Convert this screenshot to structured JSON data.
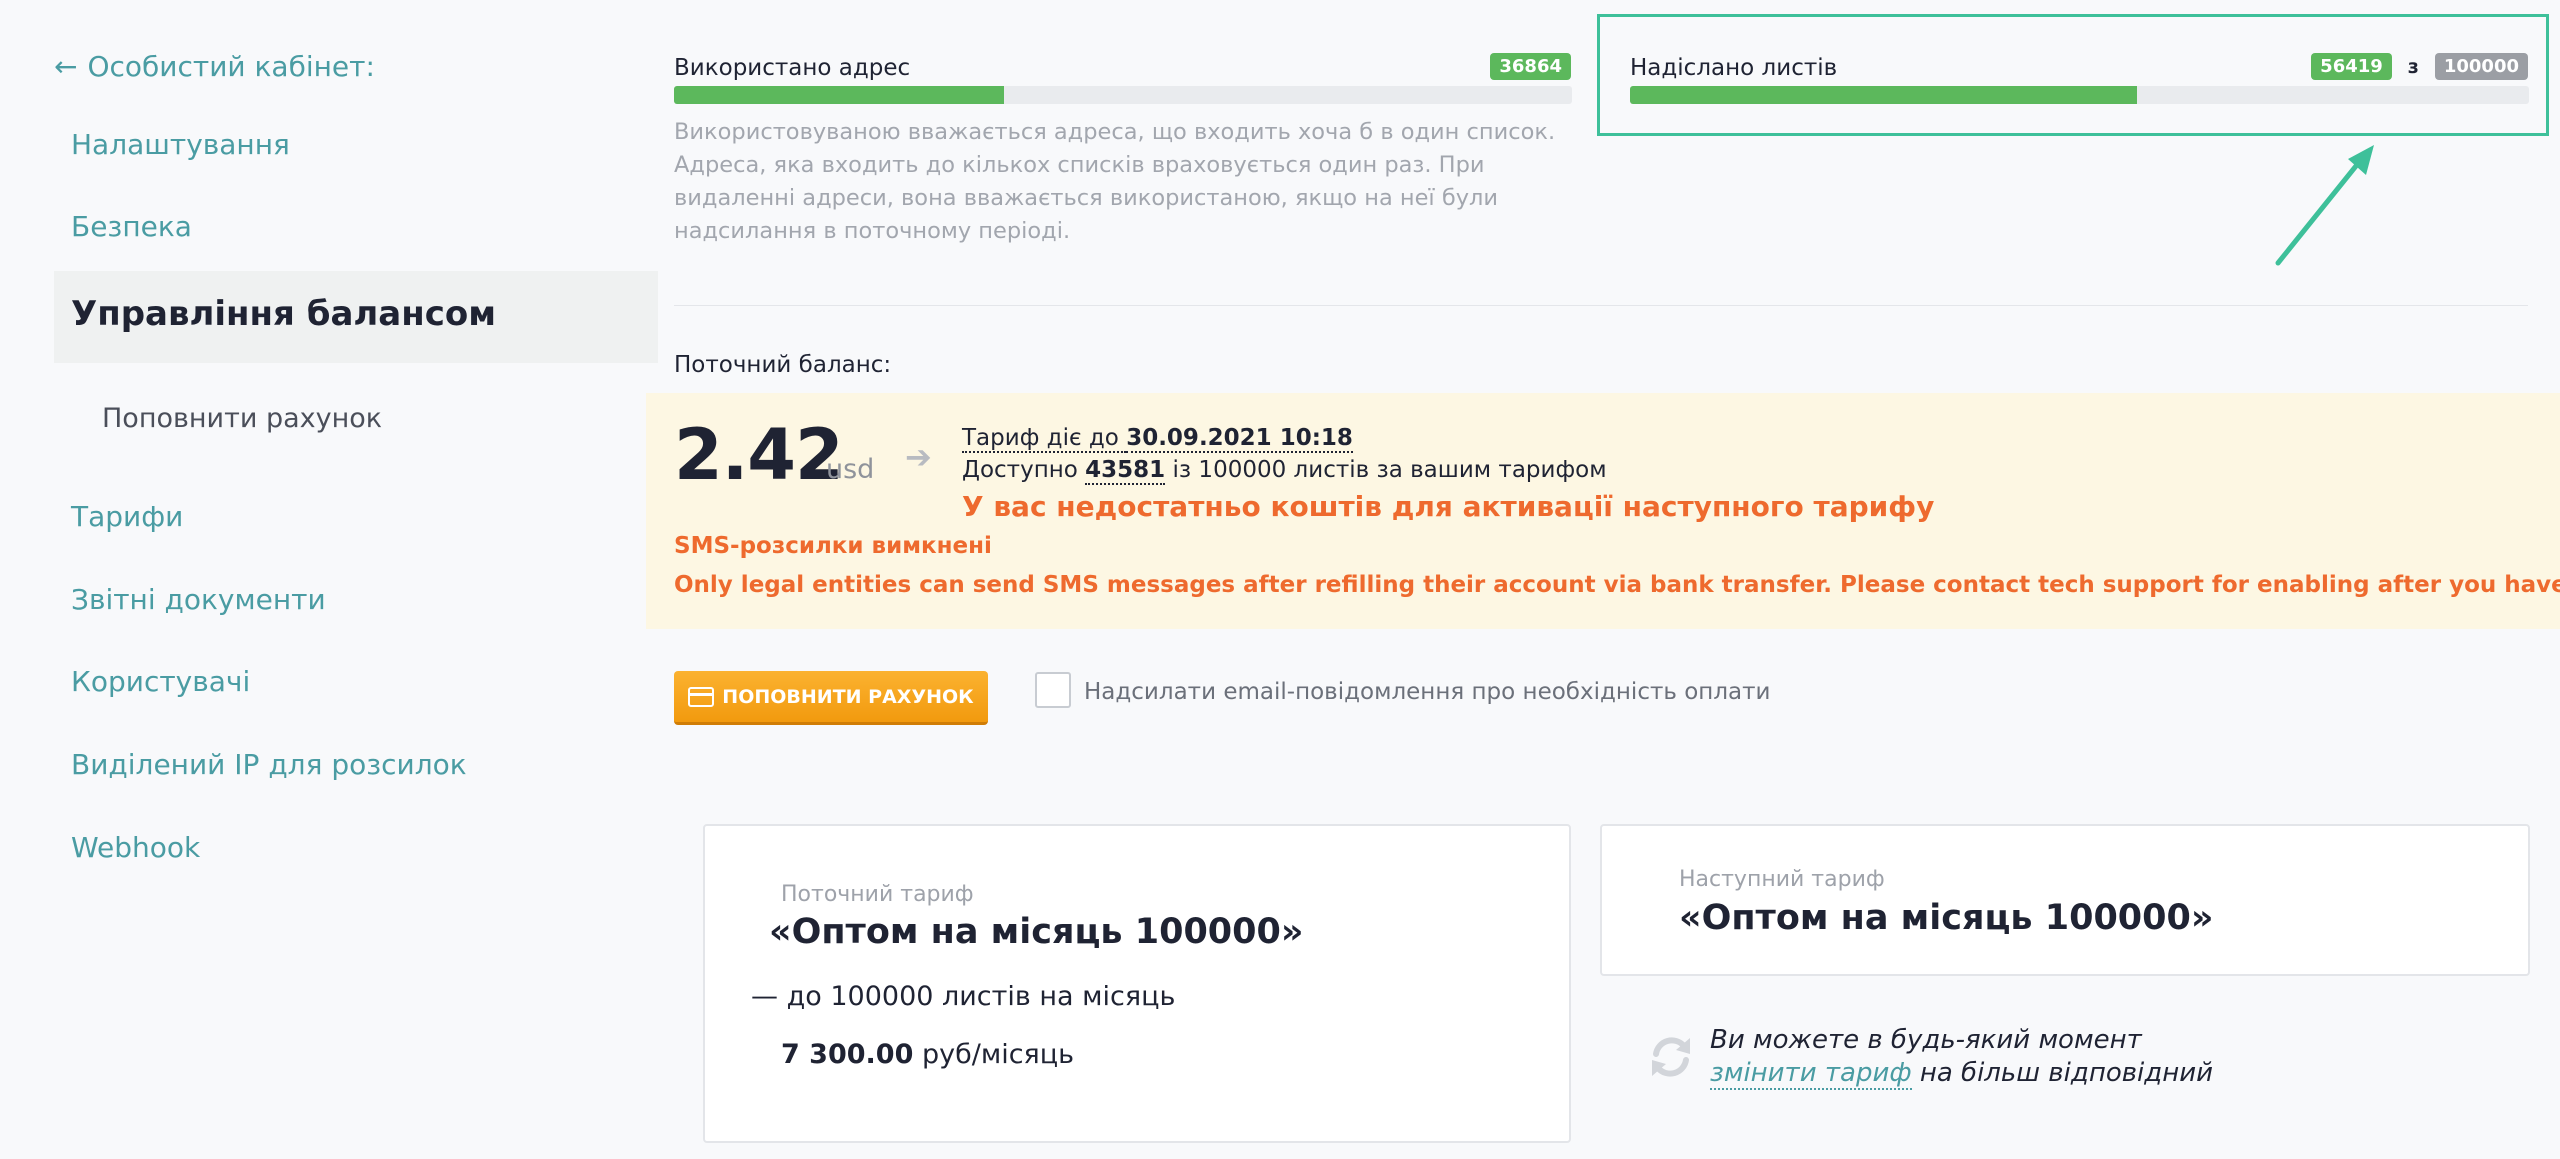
{
  "sidebar": {
    "back_label": "Особистий кабінет:",
    "items": [
      {
        "label": "Налаштування"
      },
      {
        "label": "Безпека"
      },
      {
        "label": "Управління балансом"
      },
      {
        "label": "Поповнити рахунок"
      },
      {
        "label": "Тарифи"
      },
      {
        "label": "Звітні документи"
      },
      {
        "label": "Користувачі"
      },
      {
        "label": "Виділений IP для розсилок"
      },
      {
        "label": "Webhook"
      }
    ]
  },
  "usage": {
    "addresses": {
      "label": "Використано адрес",
      "count": "36864",
      "fill_fraction": 0.368,
      "note": "Використовуваною вважається адреса, що входить хоча б в один список. Адреса, яка входить до кількох списків враховується один раз. При видаленні адреси, вона вважається використаною, якщо на неї були надсилання в поточному періоді."
    },
    "letters": {
      "label": "Надіслано листів",
      "sent": "56419",
      "of": "з",
      "limit": "100000",
      "fill_fraction": 0.564
    }
  },
  "balance": {
    "label": "Поточний баланс:",
    "amount": "2.42",
    "currency": "usd",
    "tariff_valid_prefix": "Тариф діє до ",
    "tariff_valid_date": "30.09.2021 10:18",
    "available_prefix": "Доступно ",
    "available_count": "43581",
    "available_suffix": " із 100000 листів за вашим тарифом",
    "insufficient_warning": "У вас недостатньо коштів для активації наступного тарифу",
    "sms_disabled": "SMS-розсилки вимкнені",
    "sms_notice": "Only legal entities can send SMS messages after refilling their account via bank transfer. Please contact tech support for enabling after you have paid."
  },
  "actions": {
    "topup_label": "ПОПОВНИТИ РАХУНОК",
    "email_notify_label": "Надсилати email-повідомлення про необхідність оплати",
    "email_notify_checked": false
  },
  "current_tariff": {
    "caption": "Поточний тариф",
    "name": "«Оптом на місяць 100000»",
    "letters_line": "— до 100000 листів на місяць",
    "price": "7 300.00",
    "price_unit": " руб/місяць"
  },
  "next_tariff": {
    "caption": "Наступний тариф",
    "name": "«Оптом на місяць 100000»"
  },
  "change_tariff": {
    "line1": "Ви можете в будь-який момент",
    "link": "змінити тариф",
    "line2_suffix": " на більш відповідний"
  },
  "colors": {
    "accent": "#4a9ca3",
    "progress": "#5cb85c",
    "warning": "#ee6a2e",
    "highlight": "#3ec09a",
    "button": "#f29a0e"
  },
  "icons": {
    "back": "arrow-left-icon",
    "balance_arrow": "arrow-right-icon",
    "button": "credit-card-icon",
    "change": "refresh-icon",
    "annotation": "annotation-arrow-icon"
  }
}
